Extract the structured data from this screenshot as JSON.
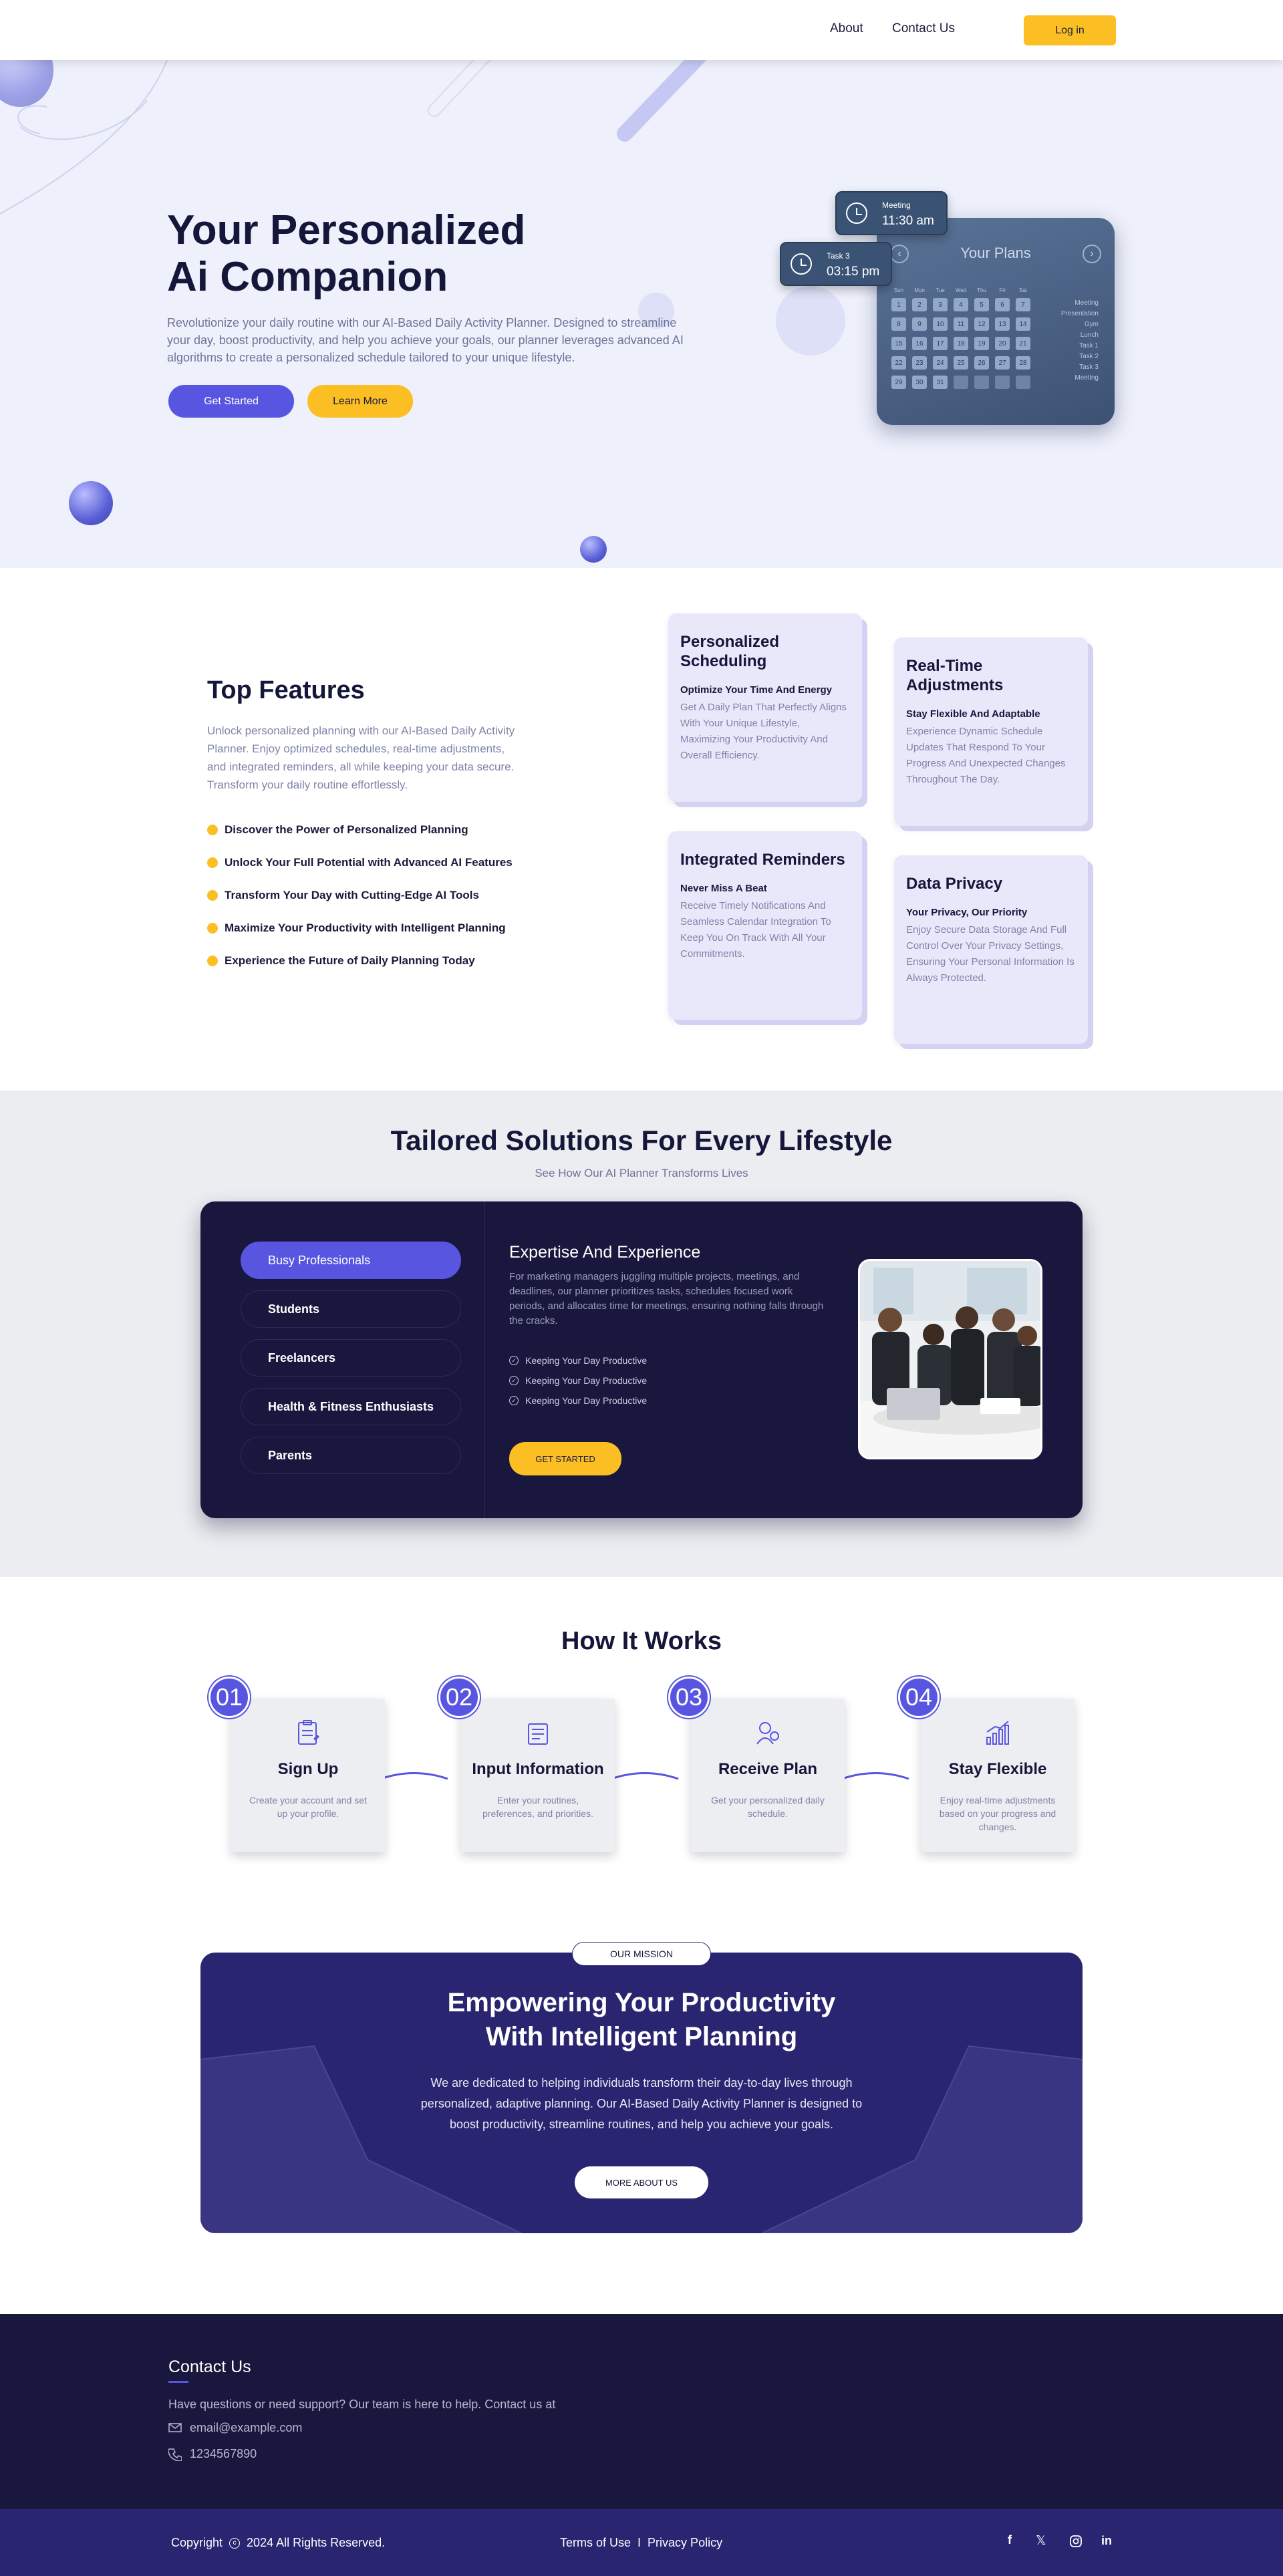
{
  "nav": {
    "about": "About",
    "contact": "Contact Us",
    "login": "Log in"
  },
  "hero": {
    "title_line1": "Your Personalized",
    "title_line2": "Ai Companion",
    "description": "Revolutionize your daily routine with our AI-Based Daily Activity Planner. Designed to streamline your day, boost productivity, and help you achieve your goals, our planner leverages advanced AI algorithms to create a personalized schedule tailored to your unique lifestyle.",
    "get_started": "Get Started",
    "learn_more": "Learn More",
    "planner": {
      "title": "Your Plans",
      "days": [
        "Sun",
        "Mon",
        "Tue",
        "Wed",
        "Thu",
        "Fri",
        "Sat"
      ],
      "dates": [
        "1",
        "2",
        "3",
        "4",
        "5",
        "6",
        "7",
        "8",
        "9",
        "10",
        "11",
        "12",
        "13",
        "14",
        "15",
        "16",
        "17",
        "18",
        "19",
        "20",
        "21",
        "22",
        "23",
        "24",
        "25",
        "26",
        "27",
        "28",
        "29",
        "30",
        "31"
      ],
      "items": [
        "Meeting",
        "Presentation",
        "Gym",
        "Lunch",
        "Task 1",
        "Task 2",
        "Task 3",
        "Meeting"
      ]
    },
    "chip_meeting": {
      "label": "Meeting",
      "time": "11:30 am"
    },
    "chip_task": {
      "label": "Task 3",
      "time": "03:15 pm"
    }
  },
  "features": {
    "title": "Top Features",
    "description": "Unlock personalized planning with our AI-Based Daily Activity Planner. Enjoy optimized schedules, real-time adjustments, and integrated reminders, all while keeping your data secure. Transform your daily routine effortlessly.",
    "bullets": [
      "Discover the Power of Personalized Planning",
      "Unlock Your Full Potential with Advanced AI Features",
      "Transform Your Day with Cutting-Edge AI Tools",
      "Maximize Your Productivity with Intelligent Planning",
      "Experience the Future of Daily Planning Today"
    ],
    "cards": [
      {
        "title": "Personalized Scheduling",
        "subtitle": "Optimize Your Time And Energy",
        "text": "Get A Daily Plan That Perfectly Aligns With Your Unique Lifestyle, Maximizing Your Productivity And Overall Efficiency."
      },
      {
        "title": "Real-Time Adjustments",
        "subtitle": "Stay Flexible And Adaptable",
        "text": "Experience Dynamic Schedule Updates That Respond To Your Progress And Unexpected Changes Throughout The Day."
      },
      {
        "title": "Integrated Reminders",
        "subtitle": "Never Miss A Beat",
        "text": "Receive Timely Notifications And Seamless Calendar Integration To Keep You On Track With All Your Commitments."
      },
      {
        "title": "Data Privacy",
        "subtitle": "Your Privacy, Our Priority",
        "text": "Enjoy Secure Data Storage And Full Control Over Your Privacy Settings, Ensuring Your Personal Information Is Always Protected."
      }
    ]
  },
  "tailored": {
    "title": "Tailored Solutions For Every Lifestyle",
    "subtitle": "See How Our AI Planner Transforms Lives",
    "tabs": [
      "Busy Professionals",
      "Students",
      "Freelancers",
      "Health & Fitness Enthusiasts",
      "Parents"
    ],
    "content_title": "Expertise And Experience",
    "content_text": "For marketing managers juggling multiple projects, meetings, and deadlines, our planner prioritizes tasks, schedules focused work periods, and allocates time for meetings, ensuring nothing falls through the cracks.",
    "checks": [
      "Keeping Your Day Productive",
      "Keeping Your Day Productive",
      "Keeping Your Day Productive"
    ],
    "cta": "GET STARTED"
  },
  "how": {
    "title": "How It Works",
    "steps": [
      {
        "num": "01",
        "title": "Sign Up",
        "text": "Create your account and set up your profile."
      },
      {
        "num": "02",
        "title": "Input Information",
        "text": "Enter your routines, preferences, and priorities."
      },
      {
        "num": "03",
        "title": "Receive Plan",
        "text": "Get your personalized daily schedule."
      },
      {
        "num": "04",
        "title": "Stay Flexible",
        "text": "Enjoy real-time adjustments based on your progress and changes."
      }
    ]
  },
  "mission": {
    "badge": "OUR MISSION",
    "title_line1": "Empowering Your Productivity",
    "title_line2": "With Intelligent Planning",
    "text": "We are dedicated to helping individuals transform their day-to-day lives through personalized, adaptive planning. Our AI-Based Daily Activity Planner is designed to boost productivity, streamline routines, and help you achieve your goals.",
    "button": "MORE ABOUT US"
  },
  "footer": {
    "title": "Contact Us",
    "text": "Have questions or need support? Our team is here to help. Contact us at",
    "email": "email@example.com",
    "phone": "1234567890",
    "copyright": "Copyright",
    "rights": "2024 All Rights Reserved.",
    "terms": "Terms of Use",
    "separator": "I",
    "privacy": "Privacy Policy"
  },
  "colors": {
    "primary": "#5856e0",
    "accent": "#fbbf24",
    "dark": "#19173d",
    "mission": "#2a2570"
  }
}
